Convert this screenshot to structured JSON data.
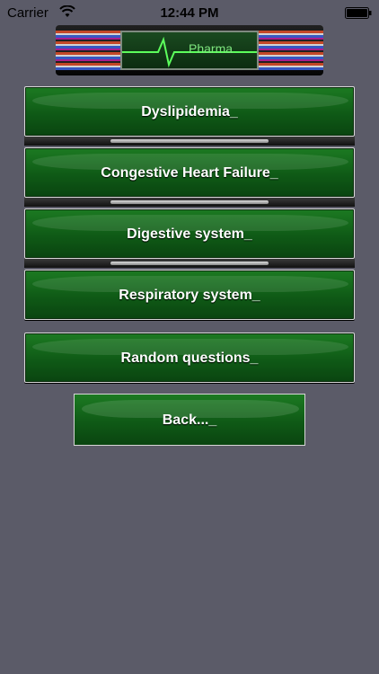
{
  "status_bar": {
    "carrier": "Carrier",
    "time": "12:44 PM"
  },
  "header": {
    "logo_text": "Pharma"
  },
  "menu": [
    {
      "label": "Dyslipidemia_"
    },
    {
      "label": "Congestive Heart Failure_"
    },
    {
      "label": "Digestive system_"
    },
    {
      "label": "Respiratory system_"
    },
    {
      "label": "Random questions_"
    }
  ],
  "back": {
    "label": "Back..._"
  },
  "colors": {
    "background": "#5b5b68",
    "button_green": "#0f5a16",
    "button_border": "#d7d7d7",
    "logo_green": "#7ee67e"
  }
}
